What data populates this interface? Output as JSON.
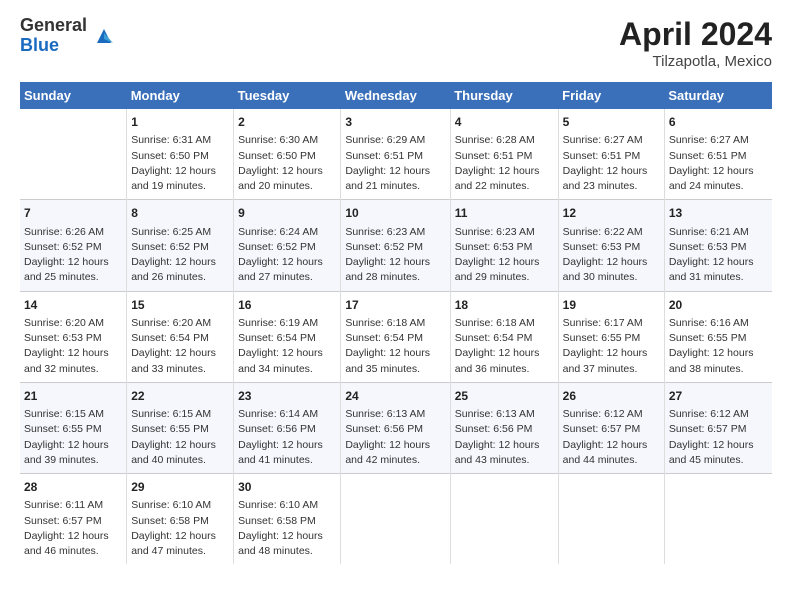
{
  "header": {
    "logo_general": "General",
    "logo_blue": "Blue",
    "title": "April 2024",
    "location": "Tilzapotla, Mexico"
  },
  "calendar": {
    "weekdays": [
      "Sunday",
      "Monday",
      "Tuesday",
      "Wednesday",
      "Thursday",
      "Friday",
      "Saturday"
    ],
    "rows": [
      [
        {
          "day": "",
          "info": ""
        },
        {
          "day": "1",
          "info": "Sunrise: 6:31 AM\nSunset: 6:50 PM\nDaylight: 12 hours and 19 minutes."
        },
        {
          "day": "2",
          "info": "Sunrise: 6:30 AM\nSunset: 6:50 PM\nDaylight: 12 hours and 20 minutes."
        },
        {
          "day": "3",
          "info": "Sunrise: 6:29 AM\nSunset: 6:51 PM\nDaylight: 12 hours and 21 minutes."
        },
        {
          "day": "4",
          "info": "Sunrise: 6:28 AM\nSunset: 6:51 PM\nDaylight: 12 hours and 22 minutes."
        },
        {
          "day": "5",
          "info": "Sunrise: 6:27 AM\nSunset: 6:51 PM\nDaylight: 12 hours and 23 minutes."
        },
        {
          "day": "6",
          "info": "Sunrise: 6:27 AM\nSunset: 6:51 PM\nDaylight: 12 hours and 24 minutes."
        }
      ],
      [
        {
          "day": "7",
          "info": "Sunrise: 6:26 AM\nSunset: 6:52 PM\nDaylight: 12 hours and 25 minutes."
        },
        {
          "day": "8",
          "info": "Sunrise: 6:25 AM\nSunset: 6:52 PM\nDaylight: 12 hours and 26 minutes."
        },
        {
          "day": "9",
          "info": "Sunrise: 6:24 AM\nSunset: 6:52 PM\nDaylight: 12 hours and 27 minutes."
        },
        {
          "day": "10",
          "info": "Sunrise: 6:23 AM\nSunset: 6:52 PM\nDaylight: 12 hours and 28 minutes."
        },
        {
          "day": "11",
          "info": "Sunrise: 6:23 AM\nSunset: 6:53 PM\nDaylight: 12 hours and 29 minutes."
        },
        {
          "day": "12",
          "info": "Sunrise: 6:22 AM\nSunset: 6:53 PM\nDaylight: 12 hours and 30 minutes."
        },
        {
          "day": "13",
          "info": "Sunrise: 6:21 AM\nSunset: 6:53 PM\nDaylight: 12 hours and 31 minutes."
        }
      ],
      [
        {
          "day": "14",
          "info": "Sunrise: 6:20 AM\nSunset: 6:53 PM\nDaylight: 12 hours and 32 minutes."
        },
        {
          "day": "15",
          "info": "Sunrise: 6:20 AM\nSunset: 6:54 PM\nDaylight: 12 hours and 33 minutes."
        },
        {
          "day": "16",
          "info": "Sunrise: 6:19 AM\nSunset: 6:54 PM\nDaylight: 12 hours and 34 minutes."
        },
        {
          "day": "17",
          "info": "Sunrise: 6:18 AM\nSunset: 6:54 PM\nDaylight: 12 hours and 35 minutes."
        },
        {
          "day": "18",
          "info": "Sunrise: 6:18 AM\nSunset: 6:54 PM\nDaylight: 12 hours and 36 minutes."
        },
        {
          "day": "19",
          "info": "Sunrise: 6:17 AM\nSunset: 6:55 PM\nDaylight: 12 hours and 37 minutes."
        },
        {
          "day": "20",
          "info": "Sunrise: 6:16 AM\nSunset: 6:55 PM\nDaylight: 12 hours and 38 minutes."
        }
      ],
      [
        {
          "day": "21",
          "info": "Sunrise: 6:15 AM\nSunset: 6:55 PM\nDaylight: 12 hours and 39 minutes."
        },
        {
          "day": "22",
          "info": "Sunrise: 6:15 AM\nSunset: 6:55 PM\nDaylight: 12 hours and 40 minutes."
        },
        {
          "day": "23",
          "info": "Sunrise: 6:14 AM\nSunset: 6:56 PM\nDaylight: 12 hours and 41 minutes."
        },
        {
          "day": "24",
          "info": "Sunrise: 6:13 AM\nSunset: 6:56 PM\nDaylight: 12 hours and 42 minutes."
        },
        {
          "day": "25",
          "info": "Sunrise: 6:13 AM\nSunset: 6:56 PM\nDaylight: 12 hours and 43 minutes."
        },
        {
          "day": "26",
          "info": "Sunrise: 6:12 AM\nSunset: 6:57 PM\nDaylight: 12 hours and 44 minutes."
        },
        {
          "day": "27",
          "info": "Sunrise: 6:12 AM\nSunset: 6:57 PM\nDaylight: 12 hours and 45 minutes."
        }
      ],
      [
        {
          "day": "28",
          "info": "Sunrise: 6:11 AM\nSunset: 6:57 PM\nDaylight: 12 hours and 46 minutes."
        },
        {
          "day": "29",
          "info": "Sunrise: 6:10 AM\nSunset: 6:58 PM\nDaylight: 12 hours and 47 minutes."
        },
        {
          "day": "30",
          "info": "Sunrise: 6:10 AM\nSunset: 6:58 PM\nDaylight: 12 hours and 48 minutes."
        },
        {
          "day": "",
          "info": ""
        },
        {
          "day": "",
          "info": ""
        },
        {
          "day": "",
          "info": ""
        },
        {
          "day": "",
          "info": ""
        }
      ]
    ]
  }
}
